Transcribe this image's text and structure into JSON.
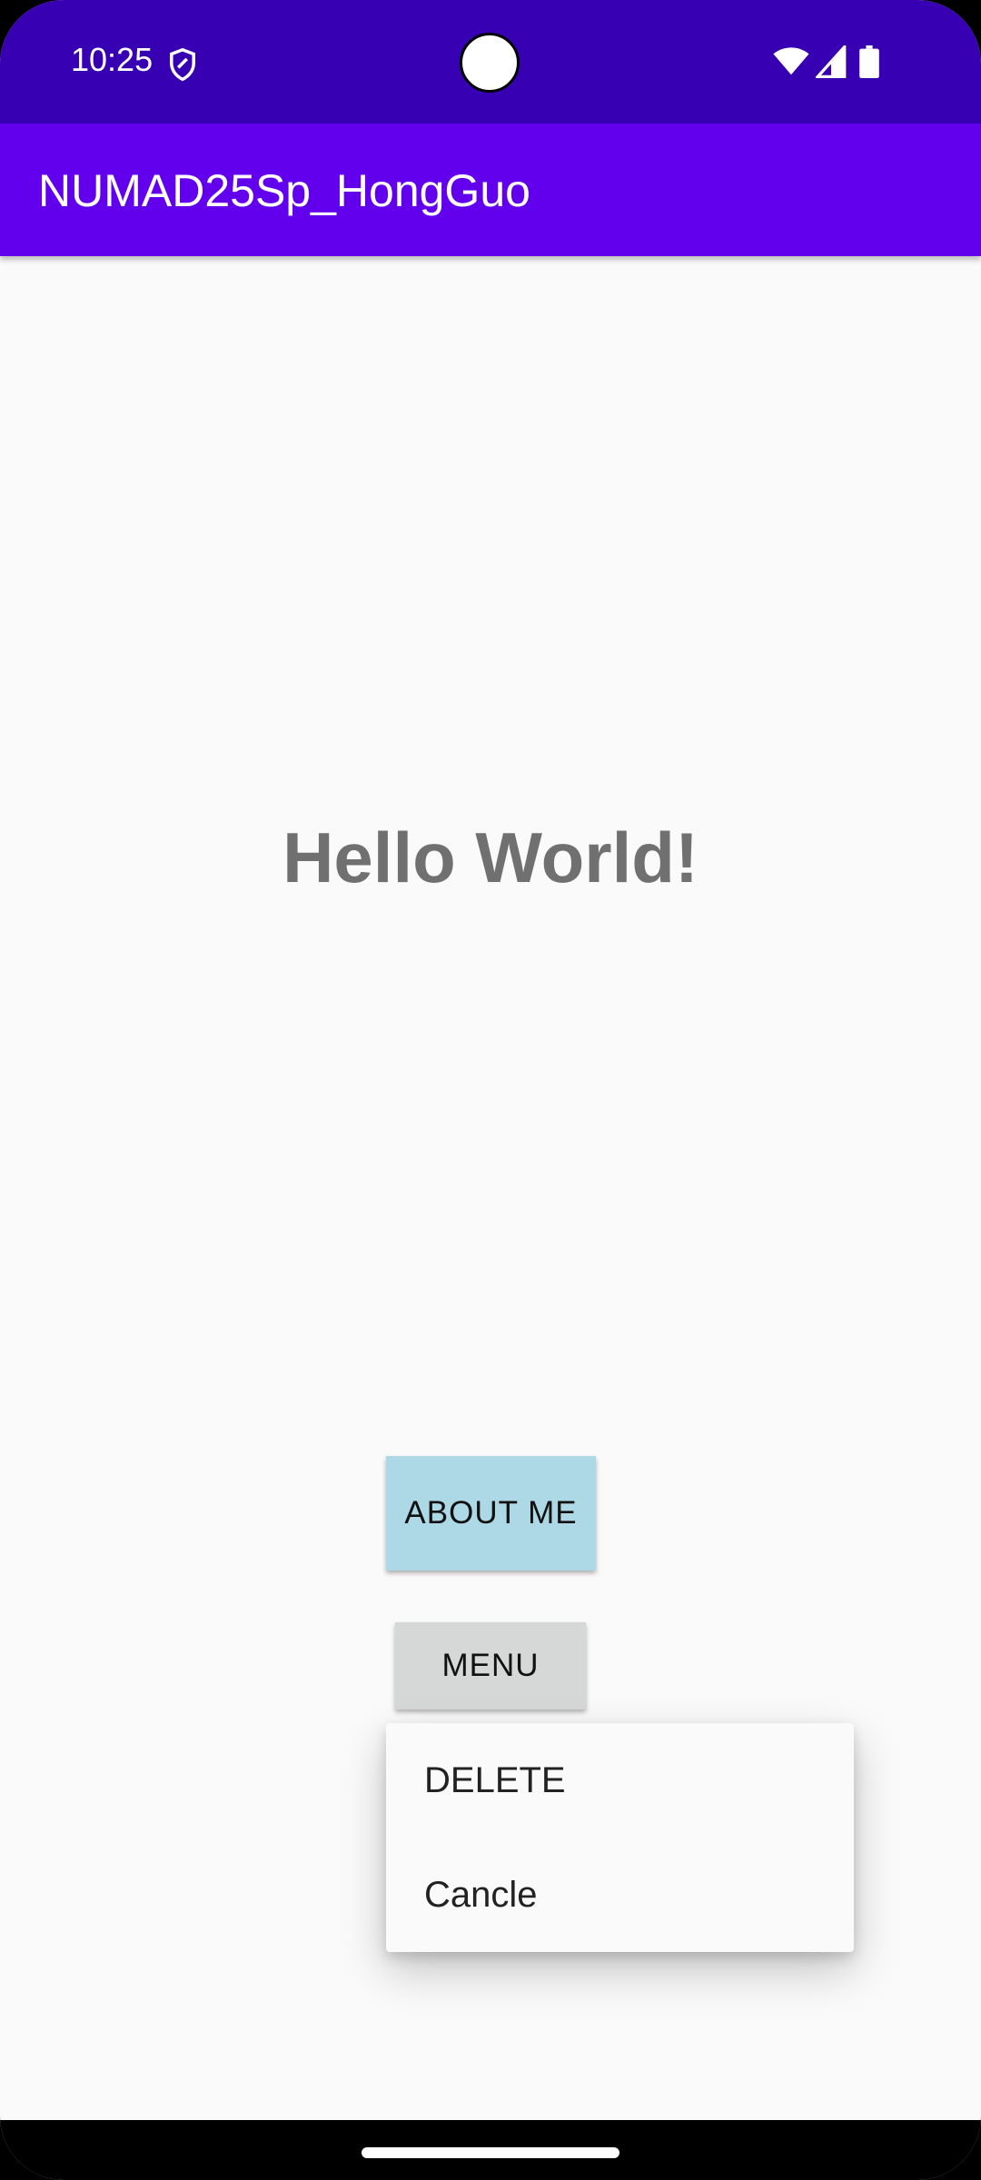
{
  "status_bar": {
    "time": "10:25",
    "background": "#3700b3",
    "icons": [
      "shield-icon",
      "wifi-icon",
      "cellular-signal-icon",
      "battery-icon"
    ]
  },
  "app_bar": {
    "title": "NUMAD25Sp_HongGuo",
    "background": "#6200ee"
  },
  "main": {
    "greeting": "Hello World!",
    "about_button_label": "ABOUT ME",
    "about_button_color": "#add8e6",
    "menu_button_label": "MENU",
    "menu_button_color": "#d6d7d7"
  },
  "popup_menu": {
    "items": [
      {
        "label": "DELETE"
      },
      {
        "label": "Cancle"
      }
    ]
  }
}
